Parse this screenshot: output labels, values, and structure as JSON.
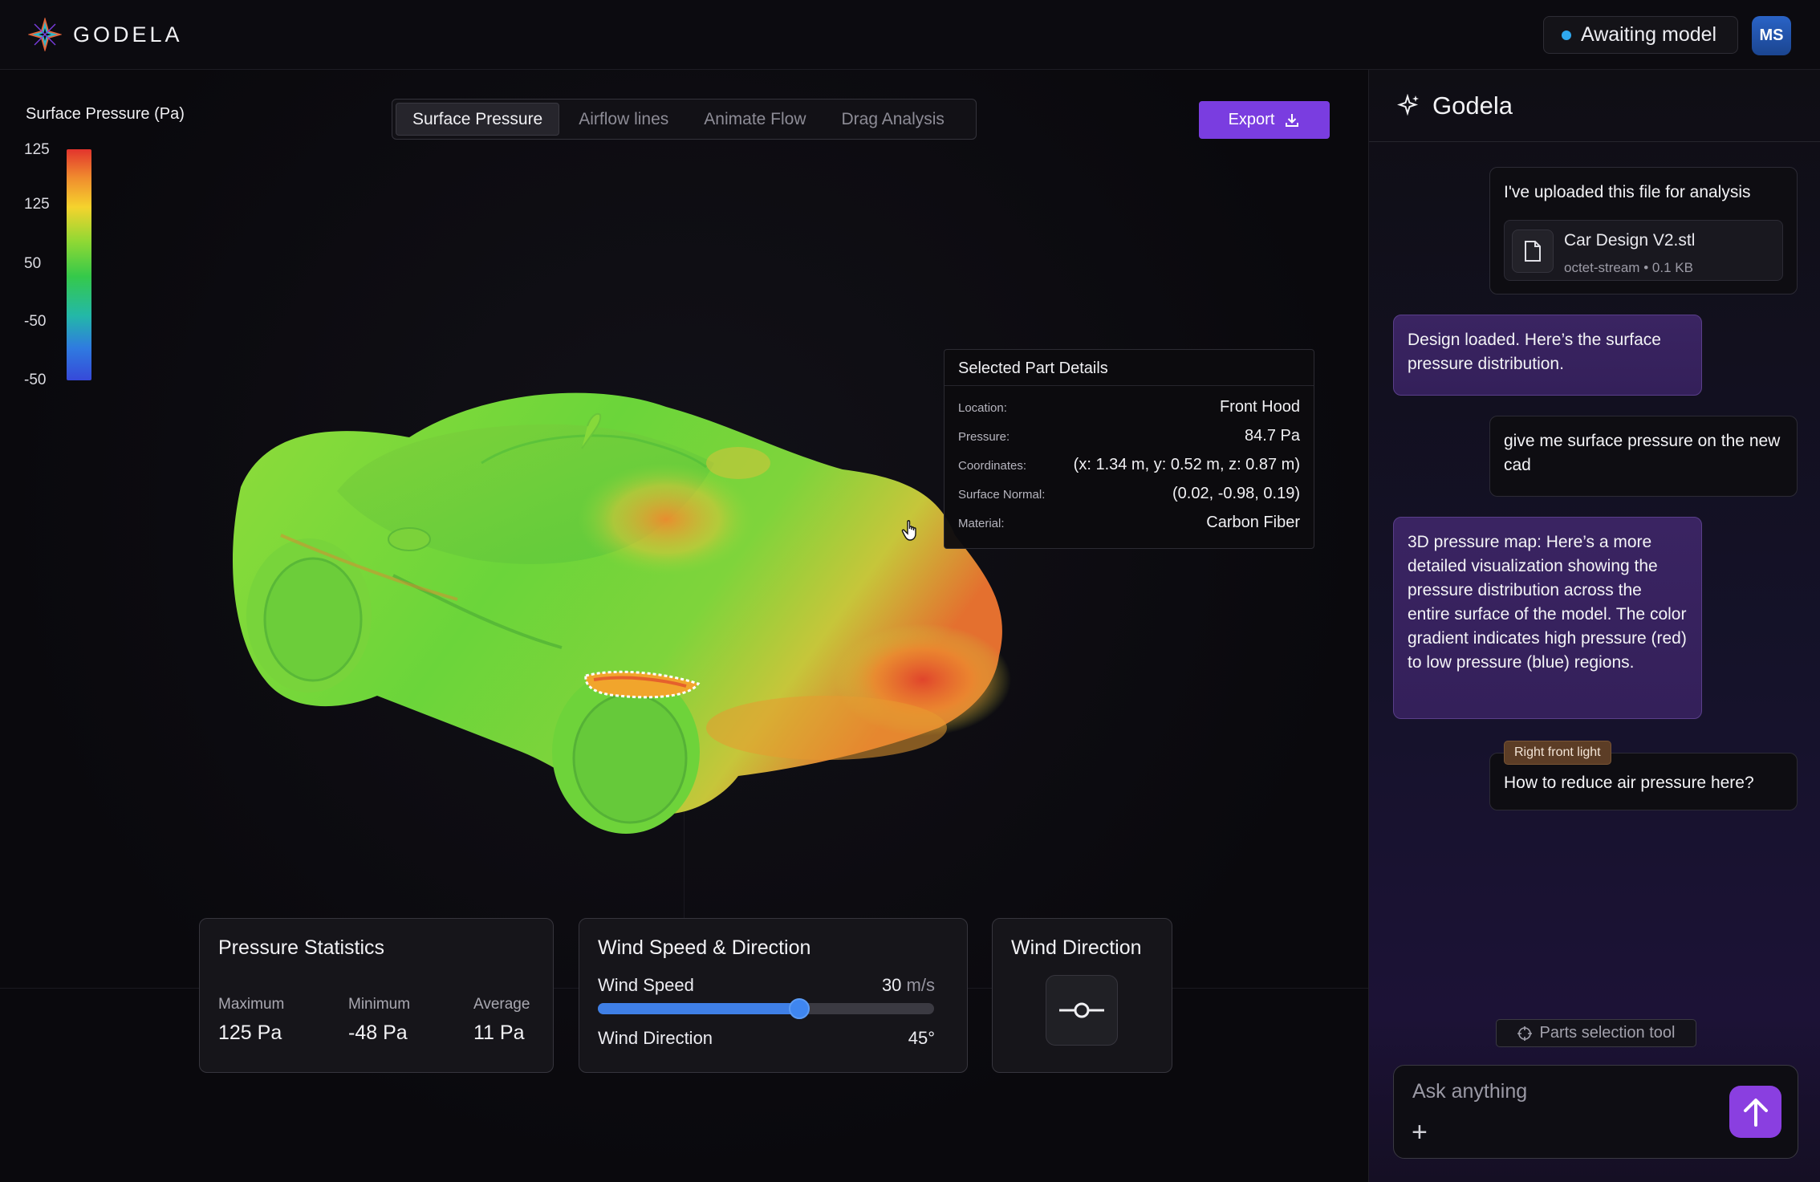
{
  "app": {
    "name": "GODELA"
  },
  "header": {
    "status": "Awaiting model",
    "avatar_initials": "MS",
    "status_color": "#2fa8ef"
  },
  "legend": {
    "title": "Surface Pressure (Pa)",
    "ticks": [
      "125",
      "125",
      "50",
      "-50",
      "-50"
    ]
  },
  "tabs": [
    {
      "label": "Surface Pressure",
      "active": true
    },
    {
      "label": "Airflow lines",
      "active": false
    },
    {
      "label": "Animate Flow",
      "active": false
    },
    {
      "label": "Drag Analysis",
      "active": false
    }
  ],
  "export": {
    "label": "Export",
    "icon": "download-icon"
  },
  "details": {
    "title": "Selected Part Details",
    "rows": [
      {
        "label": "Location:",
        "value": "Front Hood"
      },
      {
        "label": "Pressure:",
        "value": "84.7 Pa"
      },
      {
        "label": "Coordinates:",
        "value": "(x: 1.34 m, y: 0.52 m, z: 0.87 m)"
      },
      {
        "label": "Surface Normal:",
        "value": "(0.02, -0.98, 0.19)"
      },
      {
        "label": "Material:",
        "value": "Carbon Fiber"
      }
    ]
  },
  "pressure_stats": {
    "title": "Pressure Statistics",
    "items": [
      {
        "label": "Maximum",
        "value": "125 Pa"
      },
      {
        "label": "Minimum",
        "value": "-48 Pa"
      },
      {
        "label": "Average",
        "value": "11 Pa"
      }
    ]
  },
  "wind": {
    "title": "Wind Speed & Direction",
    "speed_label": "Wind Speed",
    "speed_value": "30",
    "speed_unit": "m/s",
    "speed_fraction": 0.6,
    "direction_label": "Wind Direction",
    "direction_value": "45°"
  },
  "wind_direction_card": {
    "title": "Wind Direction",
    "icon": "direction-dial-icon"
  },
  "chat": {
    "title": "Godela",
    "messages": [
      {
        "role": "user",
        "text": "I've uploaded this file for analysis",
        "file": {
          "name": "Car Design V2.stl",
          "type": "octet-stream",
          "sep": "•",
          "size": "0.1 KB"
        }
      },
      {
        "role": "assistant",
        "text": "Design loaded. Here’s the surface pressure distribution."
      },
      {
        "role": "user",
        "text": "give me surface pressure on the new cad"
      },
      {
        "role": "assistant",
        "text": "3D pressure map: Here’s a more detailed visualization showing the pressure distribution across the entire surface of the model. The color gradient indicates high pressure (red) to low pressure (blue) regions."
      },
      {
        "role": "user",
        "tag": "Right front light",
        "text": "How to reduce air pressure here?"
      }
    ],
    "parts_tool": "Parts selection tool",
    "input_placeholder": "Ask anything"
  },
  "colors": {
    "accent": "#7a3de0",
    "send": "#8a3fe0",
    "slider": "#3f7fe6"
  }
}
